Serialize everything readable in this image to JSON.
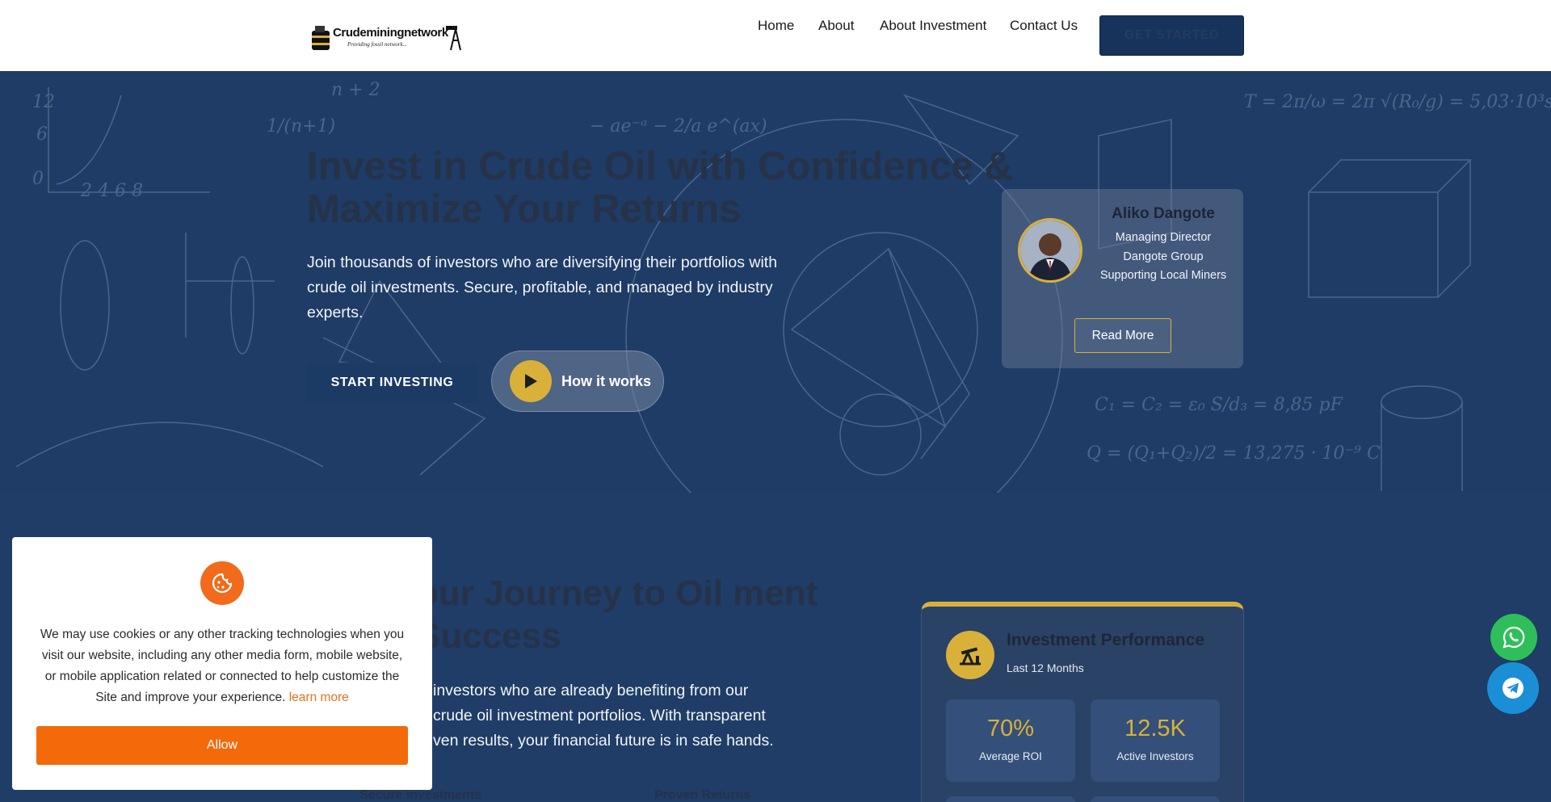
{
  "header": {
    "logo_text": "Crudeminingnetwork",
    "logo_tagline": "Providing fossil network...",
    "nav": [
      {
        "label": "Home",
        "icon": null
      },
      {
        "label": "About",
        "icon": null
      },
      {
        "label": "About Investment",
        "icon": null
      },
      {
        "label": "Contact Us",
        "icon": null
      }
    ],
    "cta_label": "GET STARTED"
  },
  "hero": {
    "title": "Invest in Crude Oil with Confidence & Maximize Your Returns",
    "subtitle": "Join thousands of investors who are diversifying their portfolios with crude oil investments. Secure, profitable, and managed by industry experts.",
    "primary_button": "START INVESTING",
    "secondary_button": "How it works",
    "profile": {
      "name": "Aliko Dangote",
      "role": "Managing Director",
      "company": "Dangote Group",
      "note": "Supporting Local Miners",
      "button": "Read More"
    }
  },
  "section2": {
    "title": "our Journey to Oil ment Success",
    "text": "investors who are already benefiting from our crude oil investment portfolios. With transparent ven results, your financial future is in safe hands.",
    "features": [
      "Secure Investments",
      "Proven Returns"
    ],
    "performance": {
      "title": "Investment Performance",
      "subtitle": "Last 12 Months",
      "stats": [
        {
          "value": "70%",
          "label": "Average ROI"
        },
        {
          "value": "12.5K",
          "label": "Active Investors"
        }
      ]
    }
  },
  "cookie": {
    "text": "We may use cookies or any other tracking technologies when you visit our website, including any other media form, mobile website, or mobile application related or connected to help customize the Site and improve your experience.",
    "link": "learn more",
    "button": "Allow"
  },
  "colors": {
    "navy": "#1e3c66",
    "gold": "#d9b13a",
    "orange": "#f26a0a",
    "whatsapp": "#2fbf5a",
    "telegram": "#1a8fd6"
  }
}
